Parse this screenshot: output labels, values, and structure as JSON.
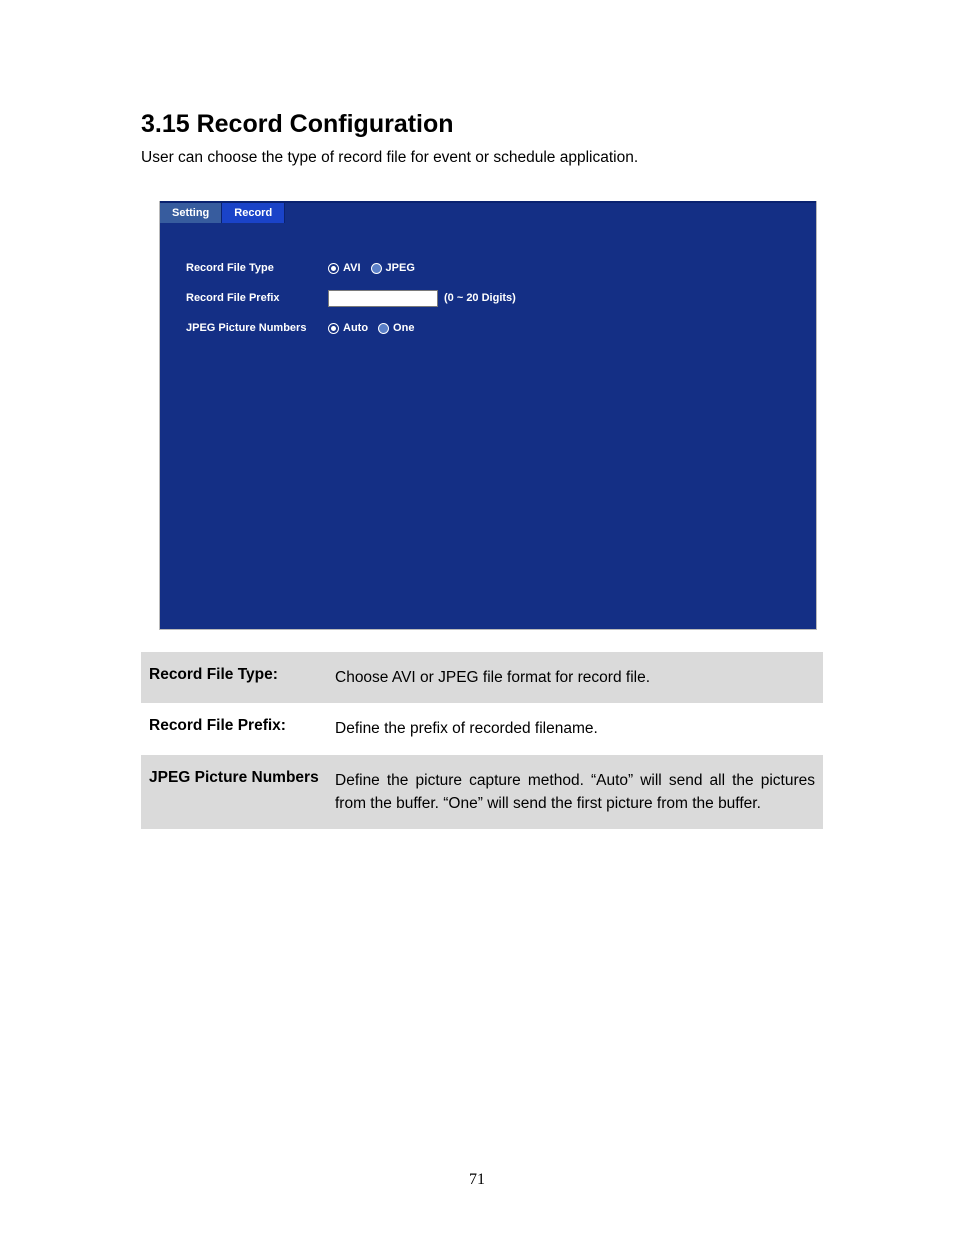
{
  "heading": "3.15 Record Configuration",
  "intro": "User can choose the type of record file for event or schedule application.",
  "screenshot": {
    "tabs": {
      "inactive": "Setting",
      "active": "Record"
    },
    "rows": {
      "fileType": {
        "label": "Record File Type",
        "opt1": "AVI",
        "opt2": "JPEG"
      },
      "prefix": {
        "label": "Record File Prefix",
        "hint": "(0 ~ 20 Digits)",
        "value": ""
      },
      "jpegNums": {
        "label": "JPEG Picture Numbers",
        "opt1": "Auto",
        "opt2": "One"
      }
    }
  },
  "descTable": {
    "r1": {
      "label": "Record File Type:",
      "text": "Choose AVI or JPEG file format for record file."
    },
    "r2": {
      "label": "Record File Prefix:",
      "text": "Define the prefix of recorded filename."
    },
    "r3": {
      "label": "JPEG Picture Numbers",
      "text": "Define the picture capture method. “Auto” will send all the pictures from the buffer. “One” will send the first picture from the buffer."
    }
  },
  "pageNumber": "71"
}
